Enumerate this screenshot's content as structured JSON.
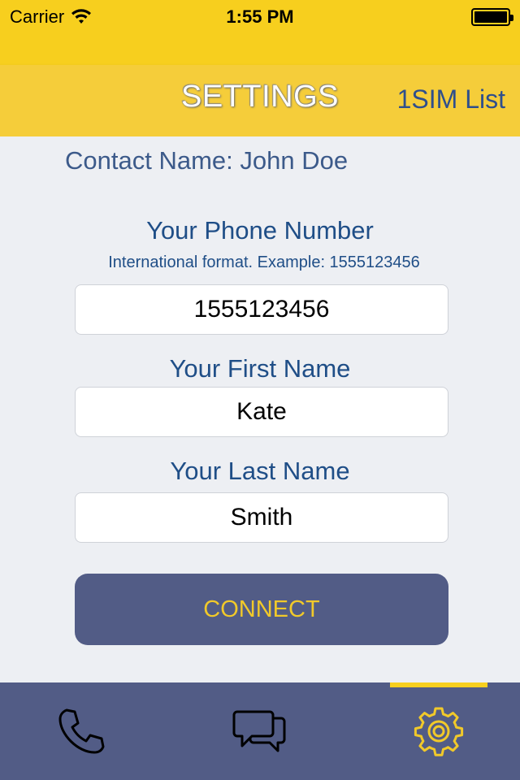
{
  "status_bar": {
    "carrier": "Carrier",
    "time": "1:55 PM"
  },
  "nav": {
    "title": "SETTINGS",
    "right_button": "1SIM List"
  },
  "contact": {
    "label": "Contact Name: John Doe"
  },
  "phone": {
    "label": "Your Phone Number",
    "hint": "International format. Example: 1555123456",
    "value": "1555123456"
  },
  "first_name": {
    "label": "Your First Name",
    "value": "Kate"
  },
  "last_name": {
    "label": "Your Last Name",
    "value": "Smith"
  },
  "connect_label": "CONNECT",
  "tabs": [
    {
      "icon": "phone-icon",
      "active": false
    },
    {
      "icon": "chat-icon",
      "active": false
    },
    {
      "icon": "gear-icon",
      "active": true
    }
  ],
  "colors": {
    "brand_yellow": "#f7cf1e",
    "tab_bar": "#525c86",
    "text_blue": "#1f4e87",
    "button_text": "#f1c92a"
  }
}
